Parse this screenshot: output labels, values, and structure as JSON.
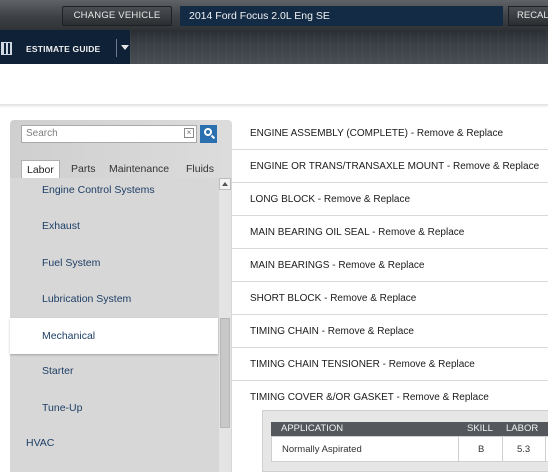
{
  "topbar": {
    "change_vehicle_label": "CHANGE VEHICLE",
    "vehicle_name": "2014 Ford Focus 2.0L Eng SE",
    "recall_label": "RECAL"
  },
  "nav": {
    "estimate_guide_label": "ESTIMATE GUIDE"
  },
  "search": {
    "placeholder": "Search"
  },
  "tabs": [
    {
      "label": "Labor",
      "active": true
    },
    {
      "label": "Parts"
    },
    {
      "label": "Maintenance"
    },
    {
      "label": "Fluids"
    }
  ],
  "categories": [
    {
      "label": "Engine Control Systems"
    },
    {
      "label": "Exhaust"
    },
    {
      "label": "Fuel System"
    },
    {
      "label": "Lubrication System"
    },
    {
      "label": "Mechanical",
      "selected": true
    },
    {
      "label": "Starter"
    },
    {
      "label": "Tune-Up"
    }
  ],
  "top_category": "HVAC",
  "operations": [
    "ENGINE ASSEMBLY (COMPLETE) - Remove & Replace",
    "ENGINE OR TRANS/TRANSAXLE MOUNT - Remove & Replace",
    "LONG BLOCK - Remove & Replace",
    "MAIN BEARING OIL SEAL - Remove & Replace",
    "MAIN BEARINGS - Remove & Replace",
    "SHORT BLOCK - Remove & Replace",
    "TIMING CHAIN - Remove & Replace",
    "TIMING CHAIN TENSIONER - Remove & Replace",
    "TIMING COVER &/OR GASKET - Remove & Replace"
  ],
  "application_table": {
    "headers": {
      "application": "APPLICATION",
      "skill": "SKILL",
      "labor": "LABOR"
    },
    "rows": [
      {
        "application": "Normally Aspirated",
        "skill": "B",
        "labor": "5.3"
      }
    ]
  }
}
